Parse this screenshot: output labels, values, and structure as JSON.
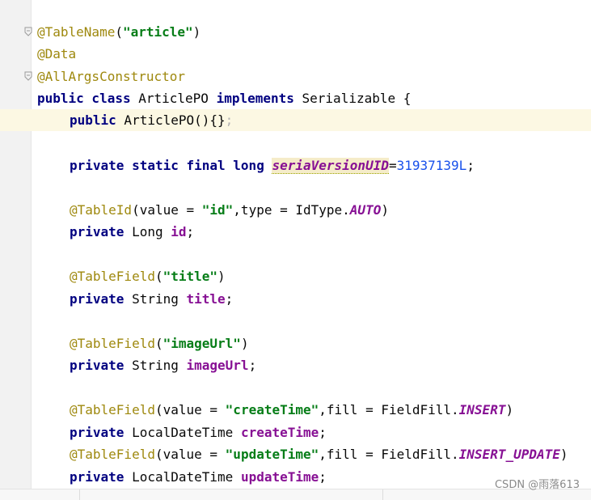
{
  "editor": {
    "lines": {
      "l1_ann": "@TableName",
      "l1_paren_open": "(",
      "l1_str": "\"article\"",
      "l1_paren_close": ")",
      "l2_ann": "@Data",
      "l3_ann": "@AllArgsConstructor",
      "l4_kw1": "public class",
      "l4_name": " ArticlePO ",
      "l4_kw2": "implements",
      "l4_rest": " Serializable {",
      "l5_kw": "public",
      "l5_rest": " ArticlePO(){}",
      "l5_semi": ";",
      "l6_kw": "private static final long",
      "l6_field": "seriaVersionUID",
      "l6_eq": "=",
      "l6_num": "31937139L",
      "l6_semi": ";",
      "l7_ann": "@TableId",
      "l7_a": "(value = ",
      "l7_str": "\"id\"",
      "l7_b": ",type = IdType.",
      "l7_const": "AUTO",
      "l7_c": ")",
      "l8_kw": "private",
      "l8_type": " Long ",
      "l8_field": "id",
      "l8_semi": ";",
      "l9_ann": "@TableField",
      "l9_a": "(",
      "l9_str": "\"title\"",
      "l9_b": ")",
      "l10_kw": "private",
      "l10_type": " String ",
      "l10_field": "title",
      "l10_semi": ";",
      "l11_ann": "@TableField",
      "l11_a": "(",
      "l11_str": "\"imageUrl\"",
      "l11_b": ")",
      "l12_kw": "private",
      "l12_type": " String ",
      "l12_field": "imageUrl",
      "l12_semi": ";",
      "l13_ann": "@TableField",
      "l13_a": "(value = ",
      "l13_str": "\"createTime\"",
      "l13_b": ",fill = FieldFill.",
      "l13_const": "INSERT",
      "l13_c": ")",
      "l14_kw": "private",
      "l14_type": " LocalDateTime ",
      "l14_field": "createTime",
      "l14_semi": ";",
      "l15_ann": "@TableField",
      "l15_a": "(value = ",
      "l15_str": "\"updateTime\"",
      "l15_b": ",fill = FieldFill.",
      "l15_const": "INSERT_UPDATE",
      "l15_c": ")",
      "l16_kw": "private",
      "l16_type": " LocalDateTime ",
      "l16_field": "updateTime",
      "l16_semi": ";"
    }
  },
  "watermark": "CSDN @雨落613"
}
